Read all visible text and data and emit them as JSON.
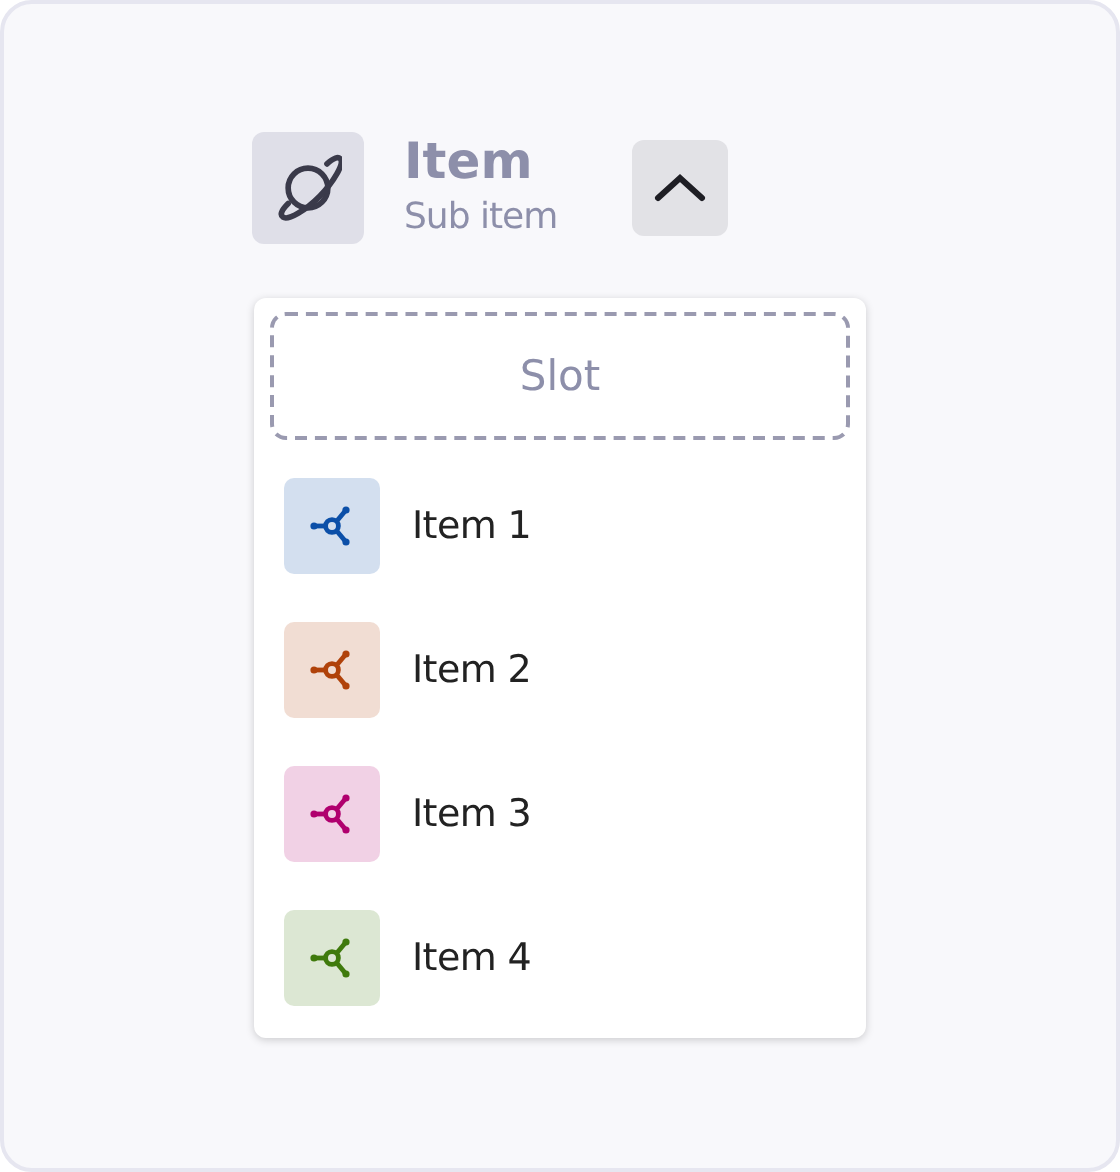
{
  "header": {
    "title": "Item",
    "subtitle": "Sub item",
    "expanded": true
  },
  "dropdown": {
    "slot": "Slot",
    "items": [
      {
        "label": "Item 1",
        "color": "#0b4fa8"
      },
      {
        "label": "Item 2",
        "color": "#b0420a"
      },
      {
        "label": "Item 3",
        "color": "#b0006e"
      },
      {
        "label": "Item 4",
        "color": "#3f7a0c"
      }
    ]
  }
}
